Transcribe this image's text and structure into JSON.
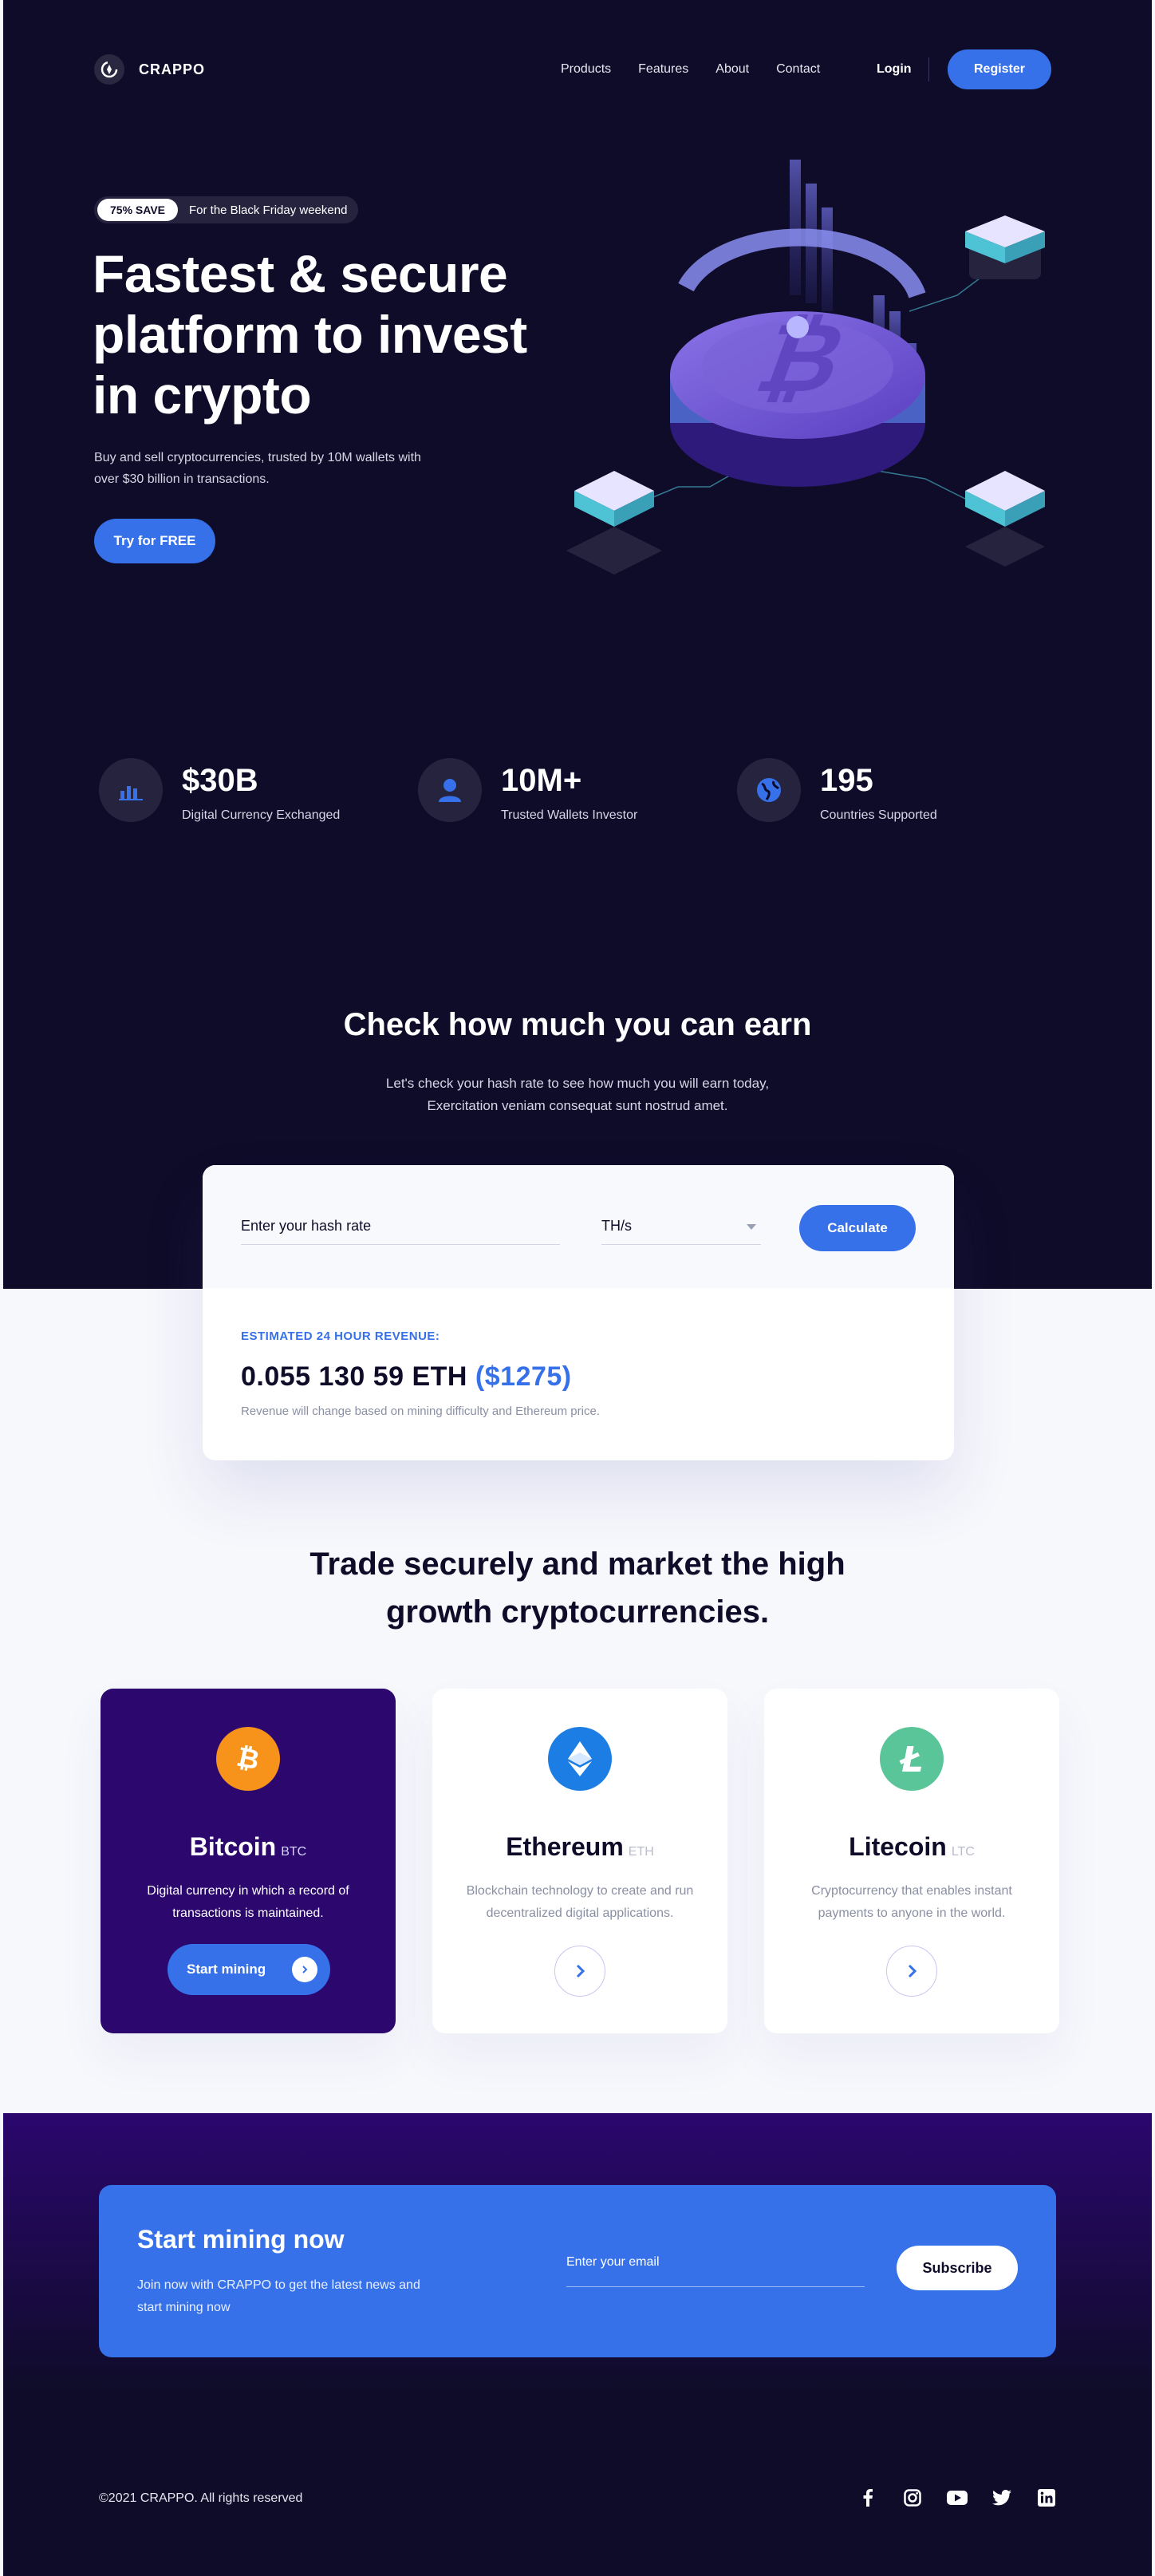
{
  "nav": {
    "logo_text": "CRAPPO",
    "links": [
      "Products",
      "Features",
      "About",
      "Contact"
    ],
    "login": "Login",
    "register": "Register"
  },
  "hero": {
    "promo_badge": "75% SAVE",
    "promo_text": "For the Black Friday weekend",
    "title_lines": [
      "Fastest & secure",
      "platform to invest",
      "in crypto"
    ],
    "subtitle": "Buy and sell cryptocurrencies, trusted by 10M wallets with over $30 billion in transactions.",
    "cta": "Try for FREE"
  },
  "stats": [
    {
      "value": "$30B",
      "label": "Digital Currency Exchanged",
      "icon": "bar-chart-icon"
    },
    {
      "value": "10M+",
      "label": "Trusted Wallets Investor",
      "icon": "user-icon"
    },
    {
      "value": "195",
      "label": "Countries Supported",
      "icon": "globe-icon"
    }
  ],
  "earn": {
    "title": "Check how much you can earn",
    "subtitle_lines": [
      "Let's check your hash rate to see how much you will earn today,",
      "Exercitation veniam consequat sunt nostrud amet."
    ],
    "input_placeholder": "Enter your hash rate",
    "unit": "TH/s",
    "calculate": "Calculate",
    "estimate_label": "ESTIMATED 24 HOUR REVENUE:",
    "estimate_eth": "0.055 130 59 ETH",
    "estimate_usd": "($1275)",
    "note": "Revenue will change based on mining difficulty and Ethereum price."
  },
  "trade": {
    "title_lines": [
      "Trade securely and market the high",
      "growth cryptocurrencies."
    ],
    "coins": [
      {
        "name": "Bitcoin",
        "symbol": "BTC",
        "desc": "Digital currency in which a record of transactions is maintained.",
        "button": "Start mining",
        "color": "#f7931a",
        "icon": "bitcoin-icon"
      },
      {
        "name": "Ethereum",
        "symbol": "ETH",
        "desc": "Blockchain technology to create and run decentralized digital applications.",
        "color": "#1c7ee5",
        "icon": "ethereum-icon"
      },
      {
        "name": "Litecoin",
        "symbol": "LTC",
        "desc": "Cryptocurrency that enables instant payments to anyone in the world.",
        "color": "#5ac598",
        "icon": "litecoin-icon"
      }
    ]
  },
  "subscribe": {
    "title": "Start mining now",
    "text": "Join now with CRAPPO to get the latest news and start mining now",
    "email_placeholder": "Enter your email",
    "button": "Subscribe"
  },
  "footer": {
    "copyright": "©2021 CRAPPO. All rights reserved",
    "socials": [
      "facebook-icon",
      "instagram-icon",
      "youtube-icon",
      "twitter-icon",
      "linkedin-icon"
    ]
  },
  "colors": {
    "dark": "#0f0c29",
    "primary": "#3671e9",
    "purple": "#2b076e"
  }
}
